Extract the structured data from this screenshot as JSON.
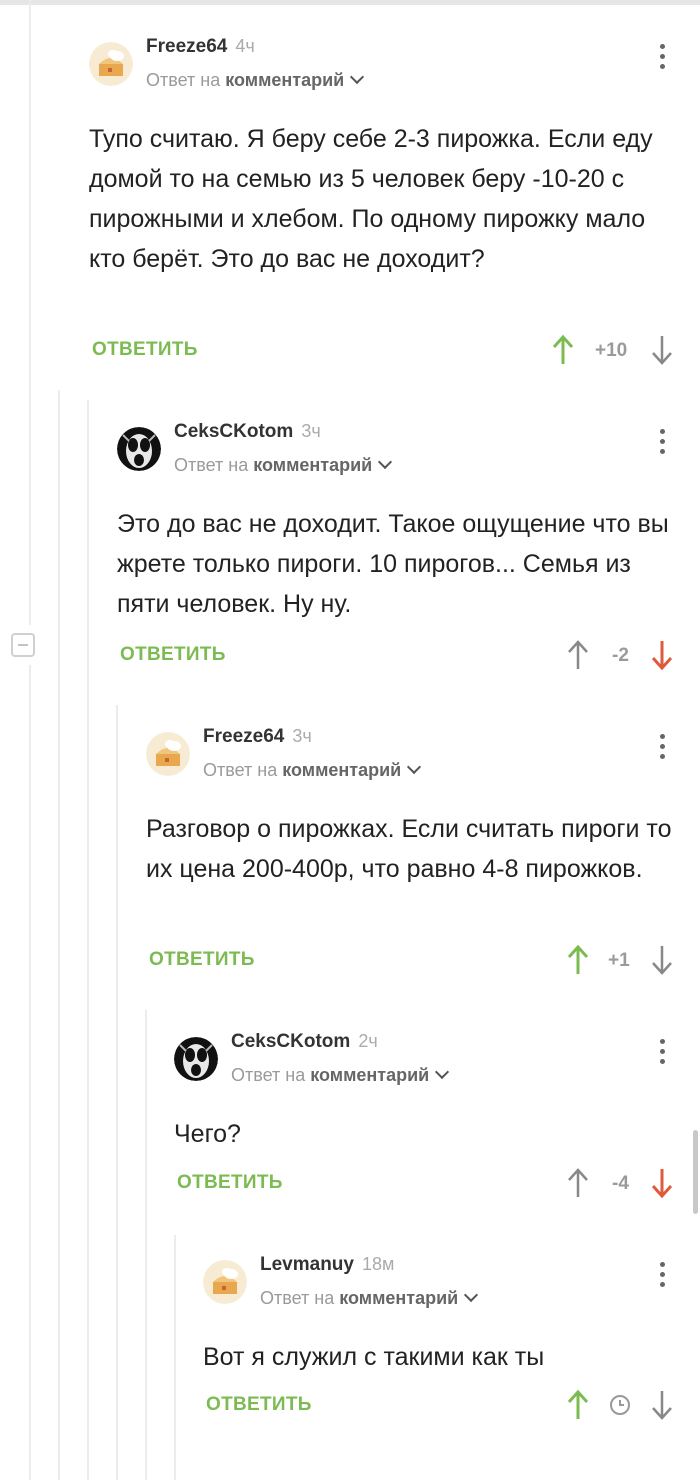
{
  "comments": [
    {
      "user": "Freeze64",
      "time": "4ч",
      "reply_prefix": "Ответ на",
      "reply_link": "комментарий",
      "text": "Тупо считаю. Я беру себе 2-3 пирожка. Если еду домой то на семью из 5 человек беру -10-20 с пирожными и хлебом. По одному пирожку мало кто берёт. Это до вас не доходит?",
      "reply_label": "ОТВЕТИТЬ",
      "score": "+10",
      "vote": "up",
      "avatar": "cake-avatar"
    },
    {
      "user": "CeksCKotom",
      "time": "3ч",
      "reply_prefix": "Ответ на",
      "reply_link": "комментарий",
      "text": "Это до вас не доходит. Такое ощущение что вы жрете только пироги. 10 пирогов... Семья из пяти человек. Ну ну.",
      "reply_label": "ОТВЕТИТЬ",
      "score": "-2",
      "vote": "down",
      "avatar": "face-avatar"
    },
    {
      "user": "Freeze64",
      "time": "3ч",
      "reply_prefix": "Ответ на",
      "reply_link": "комментарий",
      "text": "Разговор о пирожках. Если считать пироги то их цена 200-400р, что равно 4-8 пирожков.",
      "reply_label": "ОТВЕТИТЬ",
      "score": "+1",
      "vote": "up",
      "avatar": "cake-avatar"
    },
    {
      "user": "CeksCKotom",
      "time": "2ч",
      "reply_prefix": "Ответ на",
      "reply_link": "комментарий",
      "text": "Чего?",
      "reply_label": "ОТВЕТИТЬ",
      "score": "-4",
      "vote": "down",
      "avatar": "face-avatar"
    },
    {
      "user": "Levmanuy",
      "time": "18м",
      "reply_prefix": "Ответ на",
      "reply_link": "комментарий",
      "text": "Вот я служил с такими как ты",
      "reply_label": "ОТВЕТИТЬ",
      "score": "",
      "vote": "up",
      "score_icon": "clock-icon",
      "avatar": "cake-avatar"
    }
  ],
  "colors": {
    "accent_green": "#7cbb52",
    "downvote_red": "#e05a3c",
    "neutral_arrow": "#888888"
  }
}
